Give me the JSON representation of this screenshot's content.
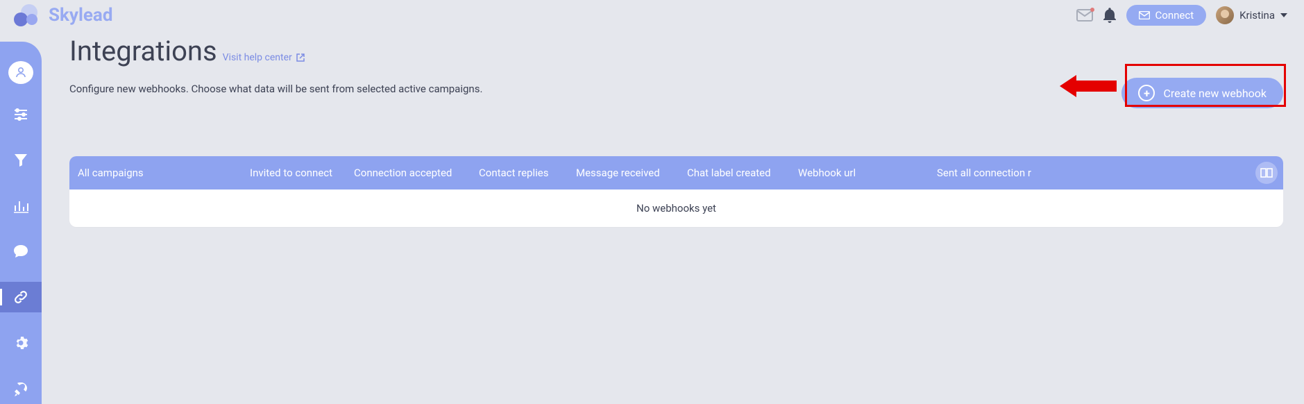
{
  "brand": {
    "name": "Skylead"
  },
  "topbar": {
    "connect_label": "Connect",
    "user_name": "Kristina"
  },
  "page": {
    "title": "Integrations",
    "help_link_label": "Visit help center",
    "subtitle": "Configure new webhooks. Choose what data will be sent from selected active campaigns.",
    "create_button_label": "Create new webhook"
  },
  "table": {
    "columns": [
      "All campaigns",
      "Invited to connect",
      "Connection accepted",
      "Contact replies",
      "Message received",
      "Chat label created",
      "Webhook url",
      "Sent all connection r"
    ],
    "empty_message": "No webhooks yet"
  },
  "sidebar": {
    "items": [
      {
        "name": "profile"
      },
      {
        "name": "sliders"
      },
      {
        "name": "funnel"
      },
      {
        "name": "analytics"
      },
      {
        "name": "chat"
      },
      {
        "name": "integrations"
      },
      {
        "name": "settings"
      },
      {
        "name": "rocket"
      }
    ]
  }
}
